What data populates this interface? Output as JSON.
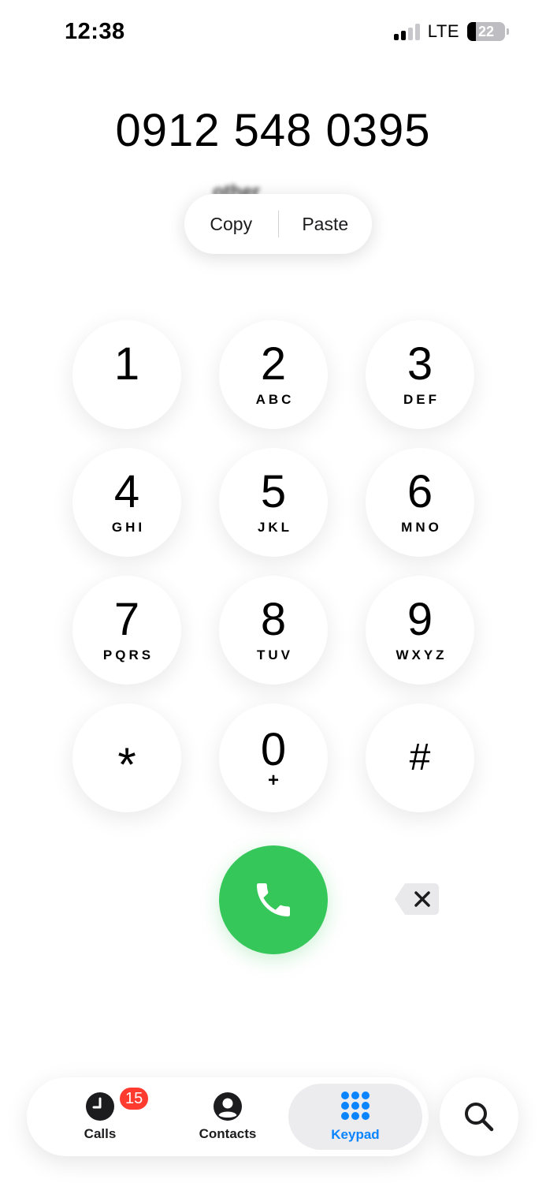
{
  "status_bar": {
    "time": "12:38",
    "network": "LTE",
    "battery_level": "22",
    "battery_fraction": 0.22,
    "signal_bars_filled": 2,
    "signal_bars_total": 4
  },
  "dialer": {
    "number": "0912 548 0395",
    "blurred_label": "other"
  },
  "context_menu": {
    "copy_label": "Copy",
    "paste_label": "Paste"
  },
  "keypad": [
    {
      "digit": "1",
      "letters": ""
    },
    {
      "digit": "2",
      "letters": "ABC"
    },
    {
      "digit": "3",
      "letters": "DEF"
    },
    {
      "digit": "4",
      "letters": "GHI"
    },
    {
      "digit": "5",
      "letters": "JKL"
    },
    {
      "digit": "6",
      "letters": "MNO"
    },
    {
      "digit": "7",
      "letters": "PQRS"
    },
    {
      "digit": "8",
      "letters": "TUV"
    },
    {
      "digit": "9",
      "letters": "WXYZ"
    },
    {
      "digit": "*",
      "letters": ""
    },
    {
      "digit": "0",
      "letters": "+"
    },
    {
      "digit": "#",
      "letters": ""
    }
  ],
  "tab_bar": {
    "calls_label": "Calls",
    "calls_badge": "15",
    "contacts_label": "Contacts",
    "keypad_label": "Keypad",
    "active_tab": "Keypad"
  },
  "colors": {
    "accent": "#0a84ff",
    "call_green": "#35c759",
    "badge_red": "#ff3b30"
  },
  "icons": {
    "call": "phone-icon",
    "delete": "backspace-icon",
    "calls_tab": "clock-icon",
    "contacts_tab": "person-circle-icon",
    "keypad_tab": "keypad-grid-icon",
    "search": "search-icon"
  }
}
